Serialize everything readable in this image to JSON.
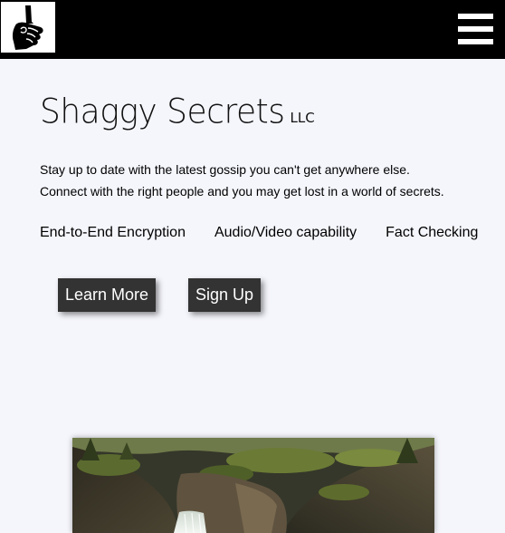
{
  "header": {
    "logo_icon": "hand-shush-icon",
    "menu_icon": "hamburger-menu-icon",
    "background_color": "#000000"
  },
  "brand": {
    "name": "Shaggy Secrets",
    "suffix": "LLC"
  },
  "tagline": {
    "line1": "Stay up to date with the latest gossip you can't get anywhere else.",
    "line2": "Connect with the right people and you may get lost in a world of secrets."
  },
  "features": [
    {
      "label": "End-to-End Encryption"
    },
    {
      "label": "Audio/Video capability"
    },
    {
      "label": "Fact Checking"
    }
  ],
  "actions": {
    "learn_more": "Learn More",
    "sign_up": "Sign Up",
    "button_color": "#333333"
  },
  "hero": {
    "subject": "forest-waterfall-canyon-image"
  },
  "page": {
    "background_color": "#f5f6fc"
  }
}
